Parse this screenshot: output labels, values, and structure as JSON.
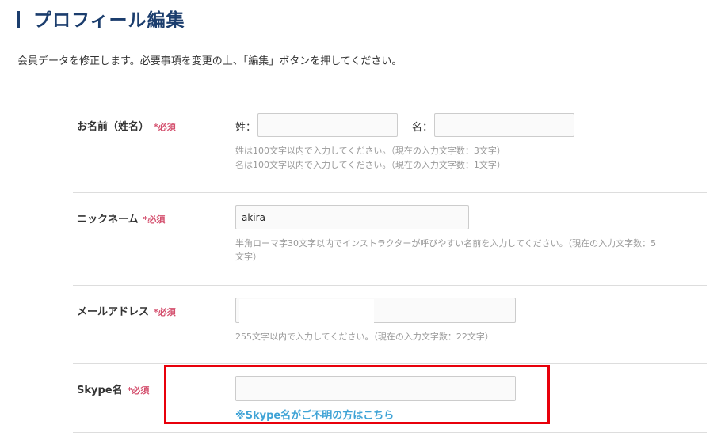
{
  "page": {
    "title": "プロフィール編集",
    "intro": "会員データを修正します。必要事項を変更の上、「編集」ボタンを押してください。"
  },
  "required_mark": "*必須",
  "name_row": {
    "label": "お名前（姓名）",
    "last_label": "姓：",
    "last_value": "",
    "first_label": "名：",
    "first_value": "",
    "help_last": "姓は100文字以内で入力してください。（現在の入力文字数：3文字）",
    "help_first": "名は100文字以内で入力してください。（現在の入力文字数：1文字）"
  },
  "nickname_row": {
    "label": "ニックネーム",
    "value": "akira",
    "help_line1": "半角ローマ字30文字以内でインストラクターが呼びやすい名前を入力してください。（現在の入力文字数：5",
    "help_line2": "文字）"
  },
  "email_row": {
    "label": "メールアドレス",
    "value": "",
    "help": "255文字以内で入力してください。（現在の入力文字数：22文字）"
  },
  "skype_row": {
    "label": "Skype名",
    "value": "",
    "link": "※Skype名がご不明の方はこちら"
  }
}
